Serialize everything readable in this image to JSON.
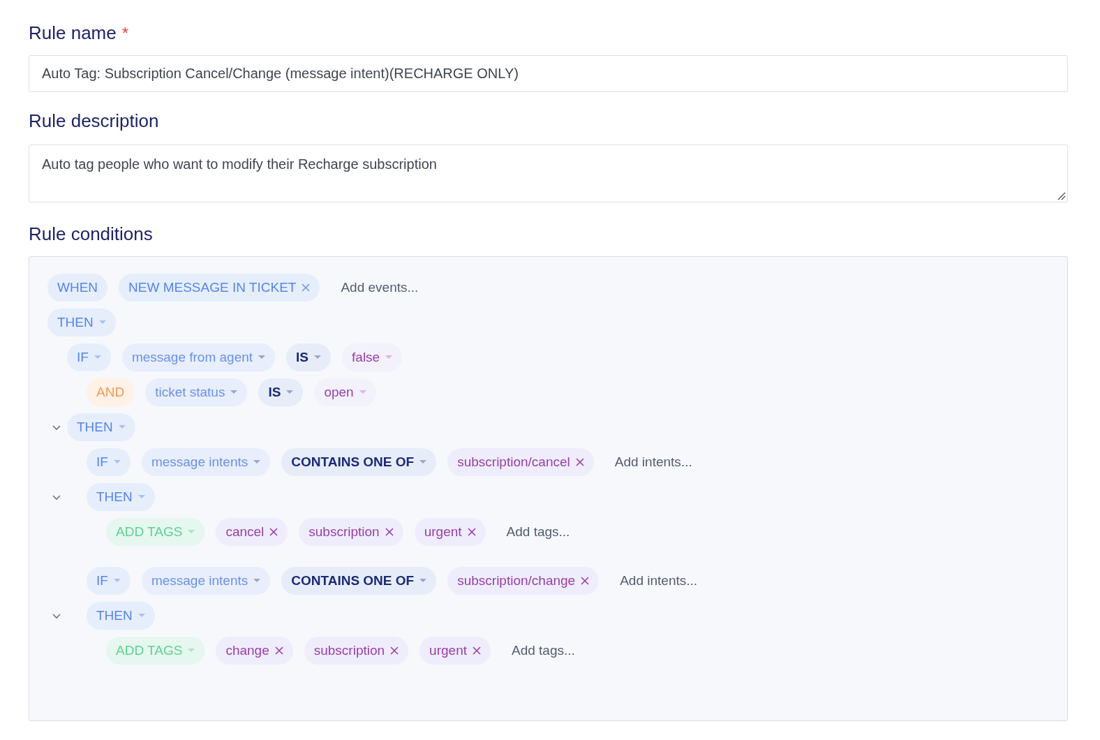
{
  "rule_name": {
    "label": "Rule name",
    "required_mark": "*",
    "value": "Auto Tag: Subscription Cancel/Change (message intent)(RECHARGE ONLY)"
  },
  "rule_description": {
    "label": "Rule description",
    "value": "Auto tag people who want to modify their Recharge subscription"
  },
  "rule_conditions": {
    "label": "Rule conditions",
    "rows": [
      {
        "chips": [
          {
            "kind": "keyword",
            "text": "WHEN",
            "dropdown": false
          },
          {
            "kind": "event",
            "text": "NEW MESSAGE IN TICKET",
            "removable": true
          },
          {
            "kind": "add",
            "text": "Add events..."
          }
        ]
      },
      {
        "chips": [
          {
            "kind": "keyword",
            "text": "THEN",
            "dropdown": true
          }
        ],
        "children": [
          {
            "chips": [
              {
                "kind": "keyword",
                "text": "IF",
                "dropdown": true
              },
              {
                "kind": "field",
                "text": "message from agent",
                "dropdown": true
              },
              {
                "kind": "operator",
                "text": "IS",
                "dropdown": true
              },
              {
                "kind": "value",
                "text": "false",
                "dropdown": true
              }
            ],
            "children": [
              {
                "chips": [
                  {
                    "kind": "logic",
                    "text": "AND",
                    "dropdown": false
                  },
                  {
                    "kind": "field",
                    "text": "ticket status",
                    "dropdown": true
                  },
                  {
                    "kind": "operator",
                    "text": "IS",
                    "dropdown": true
                  },
                  {
                    "kind": "value",
                    "text": "open",
                    "dropdown": true
                  }
                ]
              }
            ]
          },
          {
            "expanded": true,
            "chips": [
              {
                "kind": "keyword",
                "text": "THEN",
                "dropdown": true
              }
            ],
            "children": [
              {
                "chips": [
                  {
                    "kind": "keyword",
                    "text": "IF",
                    "dropdown": true
                  },
                  {
                    "kind": "field",
                    "text": "message intents",
                    "dropdown": true
                  },
                  {
                    "kind": "operator",
                    "text": "CONTAINS ONE OF",
                    "dropdown": true
                  },
                  {
                    "kind": "tag",
                    "text": "subscription/cancel",
                    "removable": true
                  },
                  {
                    "kind": "add",
                    "text": "Add intents..."
                  }
                ]
              },
              {
                "expanded": true,
                "chips": [
                  {
                    "kind": "keyword",
                    "text": "THEN",
                    "dropdown": true
                  }
                ],
                "children": [
                  {
                    "chips": [
                      {
                        "kind": "action",
                        "text": "ADD TAGS",
                        "dropdown": true
                      },
                      {
                        "kind": "tag",
                        "text": "cancel",
                        "removable": true
                      },
                      {
                        "kind": "tag",
                        "text": "subscription",
                        "removable": true
                      },
                      {
                        "kind": "tag",
                        "text": "urgent",
                        "removable": true
                      },
                      {
                        "kind": "add",
                        "text": "Add tags..."
                      }
                    ]
                  }
                ]
              },
              {
                "chips": [
                  {
                    "kind": "keyword",
                    "text": "IF",
                    "dropdown": true
                  },
                  {
                    "kind": "field",
                    "text": "message intents",
                    "dropdown": true
                  },
                  {
                    "kind": "operator",
                    "text": "CONTAINS ONE OF",
                    "dropdown": true
                  },
                  {
                    "kind": "tag",
                    "text": "subscription/change",
                    "removable": true
                  },
                  {
                    "kind": "add",
                    "text": "Add intents..."
                  }
                ]
              },
              {
                "expanded": true,
                "chips": [
                  {
                    "kind": "keyword",
                    "text": "THEN",
                    "dropdown": true
                  }
                ],
                "children": [
                  {
                    "chips": [
                      {
                        "kind": "action",
                        "text": "ADD TAGS",
                        "dropdown": true
                      },
                      {
                        "kind": "tag",
                        "text": "change",
                        "removable": true
                      },
                      {
                        "kind": "tag",
                        "text": "subscription",
                        "removable": true
                      },
                      {
                        "kind": "tag",
                        "text": "urgent",
                        "removable": true
                      },
                      {
                        "kind": "add",
                        "text": "Add tags..."
                      }
                    ]
                  }
                ]
              }
            ]
          }
        ]
      }
    ]
  }
}
